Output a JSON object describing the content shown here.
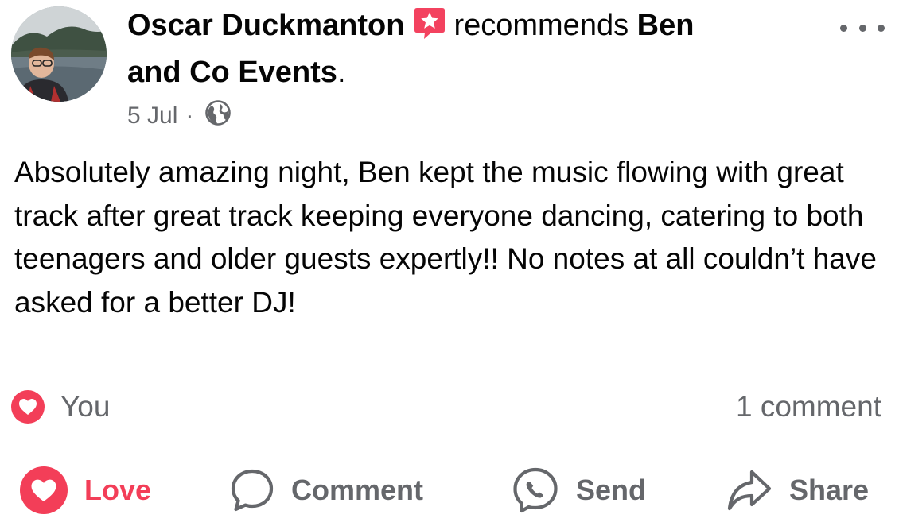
{
  "post": {
    "author": "Oscar Duckmanton",
    "recommend_verb": "recommends",
    "page_name_line1": "Ben",
    "page_name_line2": "and Co Events",
    "period": ".",
    "date": "5 Jul",
    "separator": "·",
    "privacy_icon": "globe-icon",
    "recommend_icon": "recommendation-star-icon",
    "body": "Absolutely amazing night, Ben kept the music flowing with great track after great track keeping everyone dancing, catering to both teenagers and older guests expertly!! No notes at all couldn’t have asked for a better DJ!"
  },
  "engagement": {
    "reaction_icon": "love-reaction-icon",
    "reaction_label": "You",
    "comments_label": "1 comment"
  },
  "actions": {
    "love": "Love",
    "comment": "Comment",
    "send": "Send",
    "share": "Share"
  },
  "colors": {
    "love": "#f33e58",
    "muted": "#65676b",
    "text": "#050505",
    "recommend_badge": "#f3425f"
  }
}
